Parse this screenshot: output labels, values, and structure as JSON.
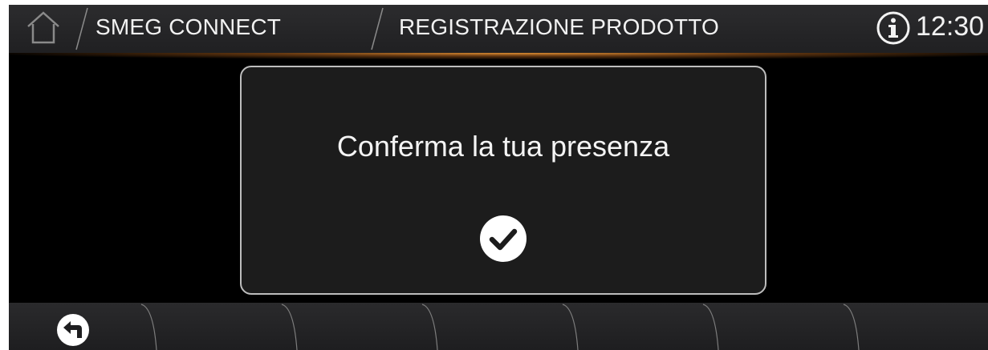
{
  "header": {
    "home_icon": "home-icon",
    "brand": "SMEG CONNECT",
    "section": "REGISTRAZIONE PRODOTTO",
    "info_icon": "info-icon",
    "time": "12:30"
  },
  "dialog": {
    "message": "Conferma la tua presenza",
    "confirm_icon": "check-circle-icon"
  },
  "footer": {
    "back_icon": "back-arrow-icon",
    "empty_slots": 6
  },
  "colors": {
    "bar": "#2a2a2c",
    "accent_glow": "#eb9637",
    "dialog_bg": "#1c1c1c",
    "dialog_border": "#bdbdbd",
    "text": "#f2f2f2"
  }
}
